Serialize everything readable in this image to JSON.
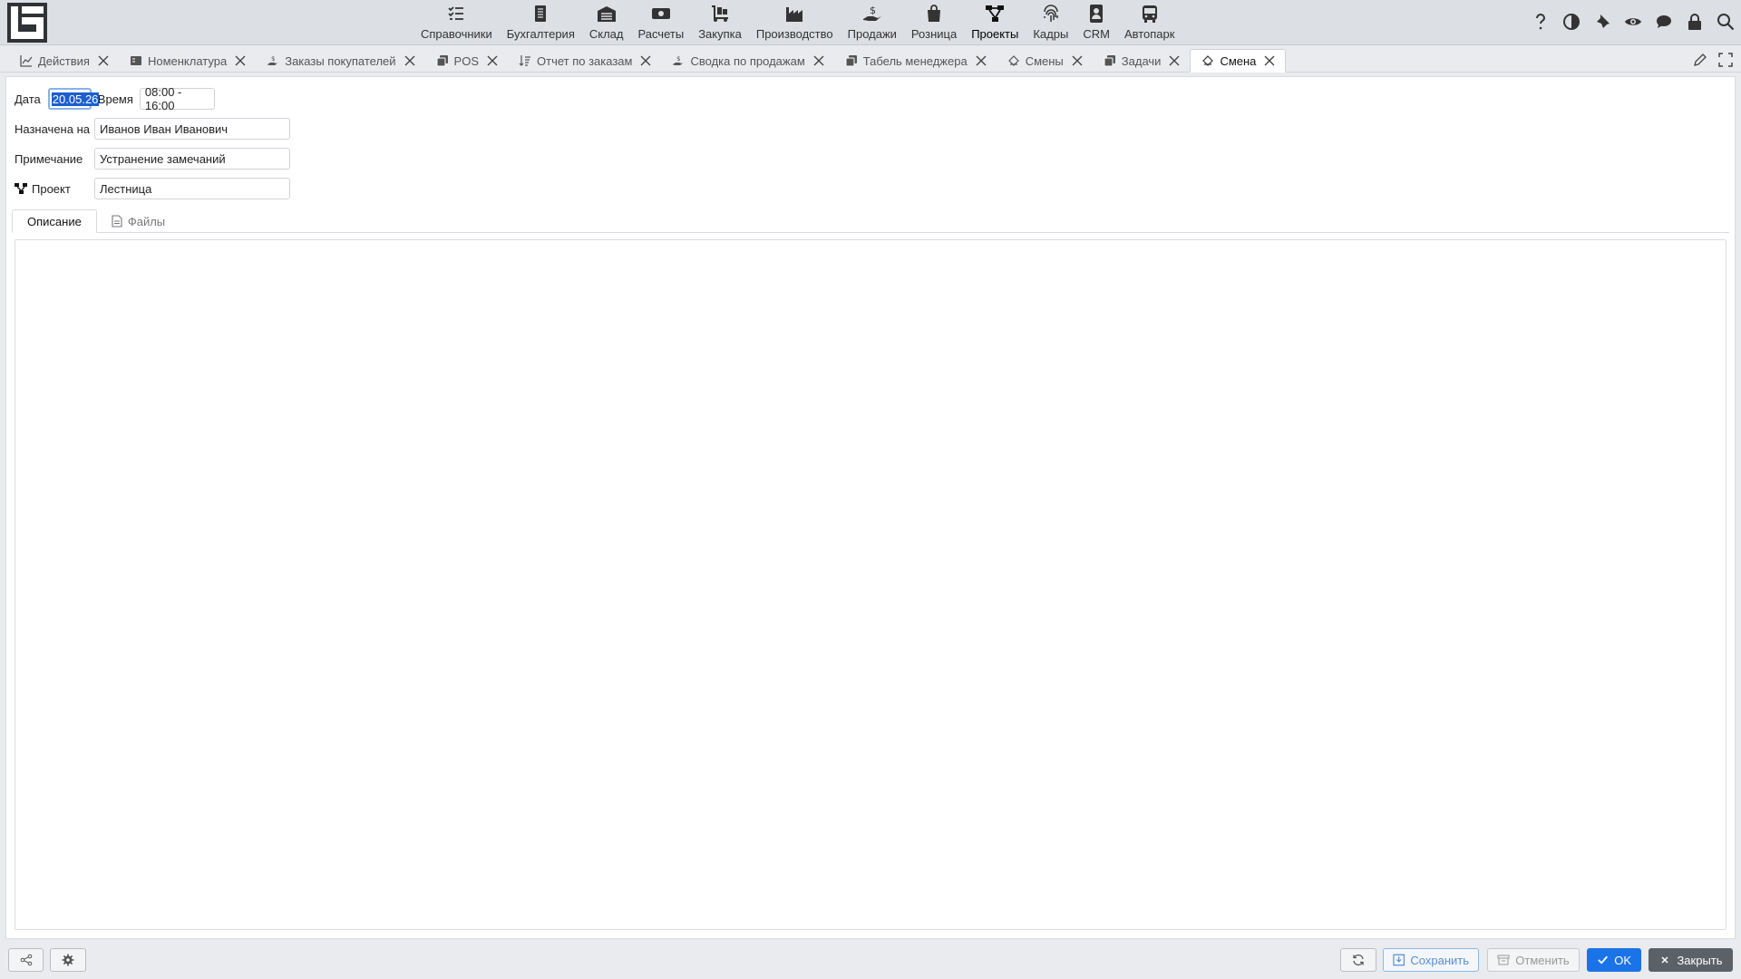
{
  "nav": {
    "modules": [
      {
        "label": "Справочники",
        "icon": "checklist-icon"
      },
      {
        "label": "Бухгалтерия",
        "icon": "ledger-icon"
      },
      {
        "label": "Склад",
        "icon": "warehouse-icon"
      },
      {
        "label": "Расчеты",
        "icon": "money-icon"
      },
      {
        "label": "Закупка",
        "icon": "dolly-icon"
      },
      {
        "label": "Производство",
        "icon": "factory-icon"
      },
      {
        "label": "Продажи",
        "icon": "hand-dollar-icon"
      },
      {
        "label": "Розница",
        "icon": "shopping-bag-icon"
      },
      {
        "label": "Проекты",
        "icon": "project-tree-icon"
      },
      {
        "label": "Кадры",
        "icon": "fingerprint-icon"
      },
      {
        "label": "CRM",
        "icon": "contact-card-icon"
      },
      {
        "label": "Автопарк",
        "icon": "bus-icon"
      }
    ],
    "active_module": "Проекты"
  },
  "tabs": [
    {
      "label": "Действия",
      "icon": "line-chart-icon"
    },
    {
      "label": "Номенклатура",
      "icon": "catalog-icon"
    },
    {
      "label": "Заказы покупателей",
      "icon": "hand-dollar-icon"
    },
    {
      "label": "POS",
      "icon": "copy-icon"
    },
    {
      "label": "Отчет по заказам",
      "icon": "sort-icon"
    },
    {
      "label": "Сводка по продажам",
      "icon": "hand-dollar-icon"
    },
    {
      "label": "Табель менеджера",
      "icon": "copy-icon"
    },
    {
      "label": "Смены",
      "icon": "shift-icon"
    },
    {
      "label": "Задачи",
      "icon": "copy-icon"
    },
    {
      "label": "Смена",
      "icon": "shift-icon",
      "active": true
    }
  ],
  "form": {
    "date_label": "Дата",
    "date_value": "20.05.26",
    "time_label": "Время",
    "time_value": "08:00 - 16:00",
    "assigned_label": "Назначена на",
    "assigned_value": "Иванов Иван Иванович",
    "note_label": "Примечание",
    "note_value": "Устранение замечаний",
    "project_label": "Проект",
    "project_value": "Лестница"
  },
  "subtabs": {
    "description": "Описание",
    "files": "Файлы"
  },
  "footer": {
    "save": "Сохранить",
    "cancel": "Отменить",
    "ok": "OK",
    "close": "Закрыть"
  },
  "colors": {
    "accent": "#1b73e8",
    "selection": "#1b5fd0",
    "close_button": "#5b6168"
  }
}
